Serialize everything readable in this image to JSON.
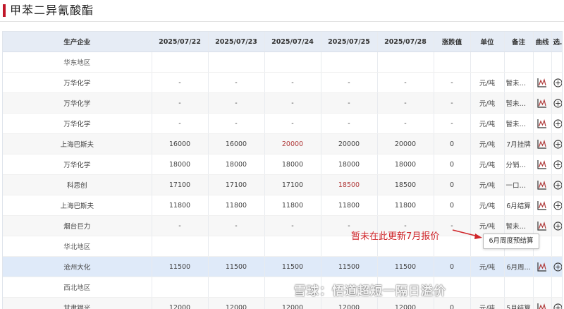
{
  "page": {
    "title": "甲苯二异氰酸酯"
  },
  "table": {
    "headers": [
      "生产企业",
      "2025/07/22",
      "2025/07/23",
      "2025/07/24",
      "2025/07/25",
      "2025/07/28",
      "涨跌值",
      "单位",
      "备注",
      "曲线",
      "选择"
    ],
    "rows": [
      {
        "type": "region",
        "company": "华东地区"
      },
      {
        "type": "data",
        "company": "万华化学",
        "d1": "-",
        "d2": "-",
        "d3": "-",
        "d4": "-",
        "d5": "-",
        "change": "-",
        "unit": "元/吨",
        "note": "暂未更新"
      },
      {
        "type": "data",
        "company": "万华化学",
        "d1": "-",
        "d2": "-",
        "d3": "-",
        "d4": "-",
        "d5": "-",
        "change": "-",
        "unit": "元/吨",
        "note": "暂未更新"
      },
      {
        "type": "data",
        "company": "万华化学",
        "d1": "-",
        "d2": "-",
        "d3": "-",
        "d4": "-",
        "d5": "-",
        "change": "-",
        "unit": "元/吨",
        "note": "暂未更新"
      },
      {
        "type": "data",
        "company": "上海巴斯夫",
        "d1": "16000",
        "d2": "16000",
        "d3": "20000",
        "d4": "20000",
        "d5": "20000",
        "change": "0",
        "unit": "元/吨",
        "note": "7月挂牌",
        "red": [
          "d3"
        ]
      },
      {
        "type": "data",
        "company": "万华化学",
        "d1": "18000",
        "d2": "18000",
        "d3": "18000",
        "d4": "18000",
        "d5": "18000",
        "change": "0",
        "unit": "元/吨",
        "note": "分销一..."
      },
      {
        "type": "data",
        "company": "科思创",
        "d1": "17100",
        "d2": "17100",
        "d3": "17100",
        "d4": "18500",
        "d5": "18500",
        "change": "0",
        "unit": "元/吨",
        "note": "一口价...",
        "red": [
          "d4"
        ]
      },
      {
        "type": "data",
        "company": "上海巴斯夫",
        "d1": "11800",
        "d2": "11800",
        "d3": "11800",
        "d4": "11800",
        "d5": "11800",
        "change": "0",
        "unit": "元/吨",
        "note": "6月结算"
      },
      {
        "type": "data",
        "company": "烟台巨力",
        "d1": "-",
        "d2": "-",
        "d3": "-",
        "d4": "-",
        "d5": "-",
        "change": "-",
        "unit": "元/吨",
        "note": "暂未更新"
      },
      {
        "type": "region",
        "company": "华北地区"
      },
      {
        "type": "data",
        "company": "沧州大化",
        "d1": "11500",
        "d2": "11500",
        "d3": "11500",
        "d4": "11500",
        "d5": "11500",
        "change": "0",
        "unit": "元/吨",
        "note": "6月周...",
        "highlight": true
      },
      {
        "type": "region",
        "company": "西北地区"
      },
      {
        "type": "data",
        "company": "甘肃银光",
        "d1": "12000",
        "d2": "12000",
        "d3": "12000",
        "d4": "12000",
        "d5": "12000",
        "change": "0",
        "unit": "元/吨",
        "note": "5月结算"
      }
    ]
  },
  "annotation": {
    "text": "暂未在此更新7月报价"
  },
  "tooltip": {
    "text": "6月周度预结算"
  },
  "watermark": {
    "text": "雪球：悟道超短一隔日溢价"
  },
  "colors": {
    "accent": "#c0172a",
    "header_bg": "#e6ecf5",
    "highlight_row": "#dfeaf9",
    "red_value": "#b03a3a",
    "annotation": "#d0262b"
  },
  "icons": {
    "curve": "line-chart-icon",
    "select": "add-circle-icon"
  }
}
